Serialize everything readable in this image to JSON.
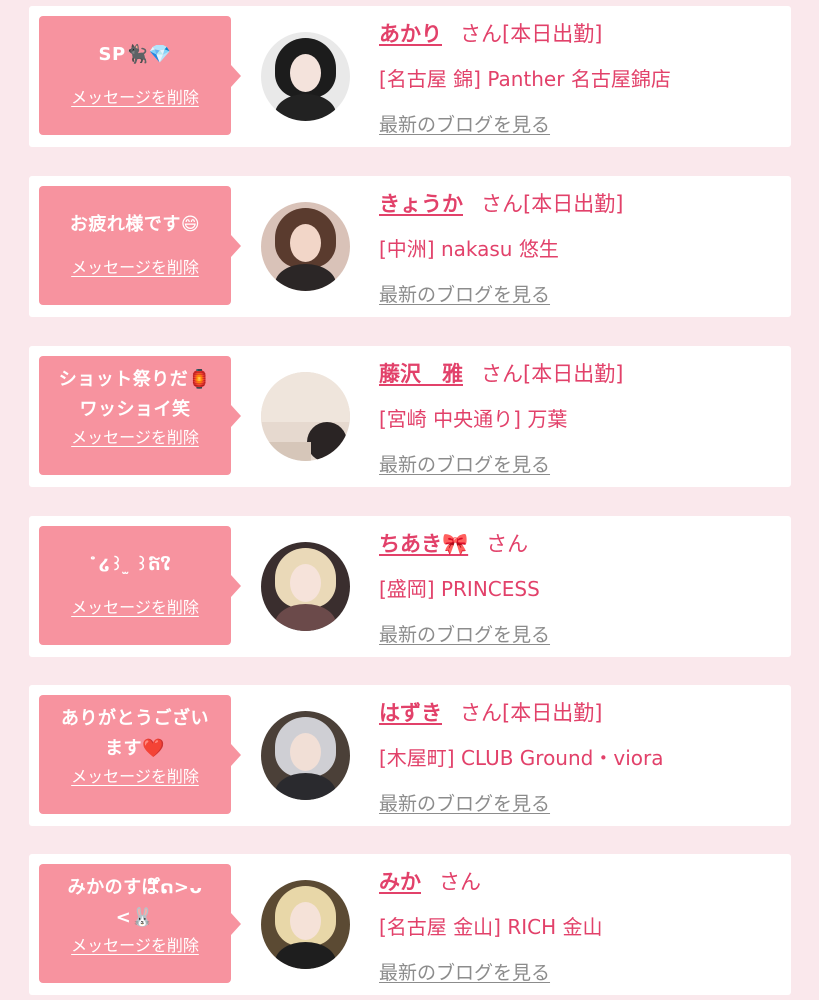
{
  "colors": {
    "page_background": "#fae8ec",
    "card_background": "#ffffff",
    "bubble_background": "#f7939f",
    "accent_text": "#e2416a",
    "link_grey": "#8c8c8c"
  },
  "cards": [
    {
      "message": "SP🐈‍⬛💎",
      "delete_label": "メッセージを削除",
      "avatar_icon": "cast-photo-avatar",
      "name": "あかり",
      "honorific": "さん",
      "status": "[本日出勤]",
      "shop": "[名古屋 錦] Panther 名古屋錦店",
      "blog_label": "最新のブログを見る"
    },
    {
      "message": "お疲れ様です😄",
      "delete_label": "メッセージを削除",
      "avatar_icon": "cast-photo-avatar",
      "name": "きょうか",
      "honorific": "さん",
      "status": "[本日出勤]",
      "shop": "[中洲] nakasu 悠生",
      "blog_label": "最新のブログを見る"
    },
    {
      "message": "ショット祭りだ🏮\nワッショイ笑",
      "delete_label": "メッセージを削除",
      "avatar_icon": "cast-photo-avatar",
      "name": "藤沢　雅",
      "honorific": "さん",
      "status": "[本日出勤]",
      "shop": "[宮崎 中央通り] 万葉",
      "blog_label": "最新のブログを見る"
    },
    {
      "message": "ໍ໒꒱ ̫ ꒱ດ໌ໃ",
      "delete_label": "メッセージを削除",
      "avatar_icon": "cast-photo-avatar",
      "name": "ちあき🎀",
      "honorific": "さん",
      "status": "",
      "shop": "[盛岡] PRINCESS",
      "blog_label": "最新のブログを見る"
    },
    {
      "message": "ありがとうござい\nます❤️",
      "delete_label": "メッセージを削除",
      "avatar_icon": "cast-photo-avatar",
      "name": "はずき",
      "honorific": "さん",
      "status": "[本日出勤]",
      "shop": "[木屋町] CLUB Ground・viora",
      "blog_label": "最新のブログを見る"
    },
    {
      "message": "みかのすぱ໌ດ>ᴗ\n<🐰",
      "delete_label": "メッセージを削除",
      "avatar_icon": "cast-photo-avatar",
      "name": "みか",
      "honorific": "さん",
      "status": "",
      "shop": "[名古屋 金山] RICH 金山",
      "blog_label": "最新のブログを見る"
    }
  ]
}
